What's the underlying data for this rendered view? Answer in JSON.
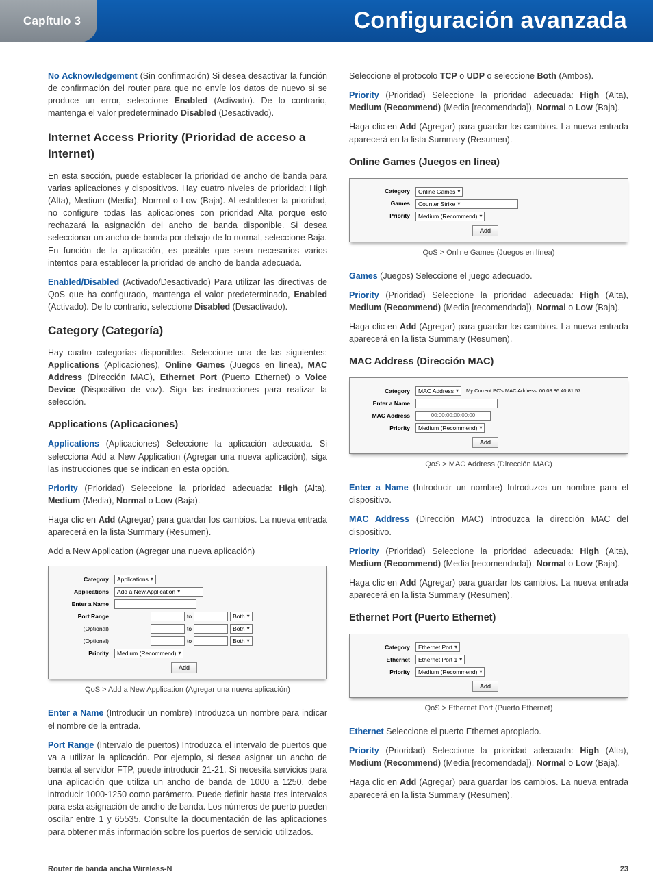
{
  "header": {
    "chapter": "Capítulo 3",
    "title": "Configuración avanzada"
  },
  "left": {
    "p1": {
      "term": "No Acknowledgement",
      "body1": " (Sin confirmación) Si desea desactivar la función de confirmación del router para que no envíe los datos de nuevo si se produce un error, seleccione ",
      "b1": "Enabled",
      "body2": " (Activado). De lo contrario, mantenga el valor predeterminado ",
      "b2": "Disabled",
      "body3": " (Desactivado)."
    },
    "h2_iap": "Internet Access Priority (Prioridad de acceso a Internet)",
    "p2": "En esta sección, puede establecer la prioridad de ancho de banda para varias aplicaciones y dispositivos. Hay cuatro niveles de prioridad: High (Alta), Medium (Media), Normal o Low (Baja). Al establecer la prioridad, no configure todas las aplicaciones con prioridad Alta porque esto rechazará la asignación del ancho de banda disponible. Si desea seleccionar un ancho de banda por debajo de lo normal, seleccione Baja. En función de la aplicación, es posible que sean necesarios varios intentos para establecer la prioridad de ancho de banda adecuada.",
    "p3": {
      "term": "Enabled/Disabled",
      "body1": " (Activado/Desactivado)  Para utilizar las directivas de QoS que ha configurado, mantenga el valor predeterminado, ",
      "b1": "Enabled",
      "body2": " (Activado). De lo contrario, seleccione ",
      "b2": "Disabled",
      "body3": " (Desactivado)."
    },
    "h2_cat": "Category (Categoría)",
    "p4": {
      "body1": "Hay cuatro categorías disponibles. Seleccione una de las siguientes: ",
      "b1": "Applications",
      "t1": " (Aplicaciones), ",
      "b2": "Online Games",
      "t2": " (Juegos en línea), ",
      "b3": "MAC Address",
      "t3": " (Dirección MAC), ",
      "b4": "Ethernet Port",
      "t4": " (Puerto Ethernet) o ",
      "b5": "Voice Device",
      "t5": " (Dispositivo de voz). Siga las instrucciones para realizar la selección."
    },
    "h3_apps": "Applications (Aplicaciones)",
    "p5": {
      "term": "Applications",
      "body": "  (Aplicaciones) Seleccione la aplicación adecuada. Si selecciona Add a New Application (Agregar una nueva aplicación), siga las instrucciones que se indican en esta opción."
    },
    "p6": {
      "term": "Priority",
      "body1": " (Prioridad) Seleccione la prioridad adecuada: ",
      "b1": "High",
      "t1": " (Alta), ",
      "b2": "Medium",
      "t2": " (Media), ",
      "b3": "Normal",
      "t3": " o ",
      "b4": "Low",
      "t4": " (Baja)."
    },
    "p7": {
      "body1": "Haga clic en ",
      "b1": "Add",
      "body2": " (Agregar) para guardar los cambios. La nueva entrada aparecerá en la lista Summary (Resumen)."
    },
    "p8": "Add a New Application (Agregar una nueva aplicación)",
    "shot_apps": {
      "category_lbl": "Category",
      "category_val": "Applications",
      "applications_lbl": "Applications",
      "applications_val": "Add a New Application",
      "entername_lbl": "Enter a Name",
      "portrange_lbl": "Port Range",
      "optional": "(Optional)",
      "to": "to",
      "both": "Both",
      "priority_lbl": "Priority",
      "priority_val": "Medium (Recommend)",
      "add_btn": "Add"
    },
    "cap_apps": "QoS > Add a New Application (Agregar una nueva aplicación)",
    "p9": {
      "term": "Enter a Name",
      "body": "  (Introducir un nombre) Introduzca un nombre para indicar el nombre de la entrada."
    },
    "p10": {
      "term": "Port Range",
      "body": "  (Intervalo de puertos) Introduzca el intervalo de puertos que va a utilizar la aplicación. Por ejemplo, si desea asignar un ancho de banda al servidor FTP, puede introducir 21-21. Si necesita servicios para una aplicación que utiliza un ancho de banda de 1000 a 1250, debe introducir 1000-1250 como parámetro. Puede definir hasta tres intervalos para esta asignación de ancho de banda. Los números de puerto pueden oscilar entre 1 y 65535. Consulte la documentación de las aplicaciones para obtener más información sobre los puertos de servicio utilizados."
    }
  },
  "right": {
    "p1": {
      "body1": "Seleccione el protocolo ",
      "b1": "TCP",
      "t1": " o ",
      "b2": "UDP",
      "t2": " o seleccione ",
      "b3": "Both",
      "t3": " (Ambos)."
    },
    "p2": {
      "term": "Priority",
      "body1": " (Prioridad) Seleccione la prioridad adecuada: ",
      "b1": "High",
      "t1": " (Alta), ",
      "b2": "Medium (Recommend)",
      "t2": " (Media [recomendada]), ",
      "b3": "Normal",
      "t3": " o ",
      "b4": "Low",
      "t4": " (Baja)."
    },
    "p3": {
      "body1": "Haga clic en ",
      "b1": "Add",
      "body2": " (Agregar) para guardar los cambios. La nueva entrada aparecerá en la lista Summary (Resumen)."
    },
    "h3_og": "Online Games (Juegos en línea)",
    "shot_og": {
      "category_lbl": "Category",
      "category_val": "Online Games",
      "games_lbl": "Games",
      "games_val": "Counter Strike",
      "priority_lbl": "Priority",
      "priority_val": "Medium (Recommend)",
      "add_btn": "Add"
    },
    "cap_og": "QoS > Online Games (Juegos en línea)",
    "p4": {
      "term": "Games",
      "body": "  (Juegos) Seleccione el juego adecuado."
    },
    "p5": {
      "term": "Priority",
      "body1": " (Prioridad) Seleccione la prioridad adecuada: ",
      "b1": "High",
      "t1": " (Alta), ",
      "b2": "Medium (Recommend)",
      "t2": " (Media [recomendada]), ",
      "b3": "Normal",
      "t3": " o ",
      "b4": "Low",
      "t4": " (Baja)."
    },
    "p6": {
      "body1": "Haga clic en ",
      "b1": "Add",
      "body2": " (Agregar) para guardar los cambios. La nueva entrada aparecerá en la lista Summary (Resumen)."
    },
    "h3_mac": "MAC Address (Dirección MAC)",
    "shot_mac": {
      "category_lbl": "Category",
      "category_val": "MAC Address",
      "side": "My Current PC's MAC Address: 00:08:86:40:81:57",
      "entername_lbl": "Enter a Name",
      "mac_lbl": "MAC Address",
      "mac_val": "00:00:00:00:00:00",
      "priority_lbl": "Priority",
      "priority_val": "Medium (Recommend)",
      "add_btn": "Add"
    },
    "cap_mac": "QoS > MAC Address (Dirección MAC)",
    "p7": {
      "term": "Enter a Name",
      "body": "  (Introducir un nombre) Introduzca un nombre para el dispositivo."
    },
    "p8": {
      "term": "MAC Address",
      "body": "  (Dirección MAC) Introduzca la dirección MAC del dispositivo."
    },
    "p9": {
      "term": "Priority",
      "body1": " (Prioridad) Seleccione la prioridad adecuada: ",
      "b1": "High",
      "t1": " (Alta), ",
      "b2": "Medium (Recommend)",
      "t2": " (Media [recomendada]), ",
      "b3": "Normal",
      "t3": " o ",
      "b4": "Low",
      "t4": " (Baja)."
    },
    "p10": {
      "body1": "Haga clic en ",
      "b1": "Add",
      "body2": " (Agregar) para guardar los cambios. La nueva entrada aparecerá en la lista Summary (Resumen)."
    },
    "h3_ep": "Ethernet Port (Puerto Ethernet)",
    "shot_ep": {
      "category_lbl": "Category",
      "category_val": "Ethernet Port",
      "eth_lbl": "Ethernet",
      "eth_val": "Ethernet Port 1",
      "priority_lbl": "Priority",
      "priority_val": "Medium (Recommend)",
      "add_btn": "Add"
    },
    "cap_ep": "QoS > Ethernet Port (Puerto Ethernet)",
    "p11": {
      "term": "Ethernet",
      "body": "  Seleccione el puerto Ethernet apropiado."
    },
    "p12": {
      "term": "Priority",
      "body1": " (Prioridad) Seleccione la prioridad adecuada: ",
      "b1": "High",
      "t1": " (Alta), ",
      "b2": "Medium (Recommend)",
      "t2": " (Media [recomendada]), ",
      "b3": "Normal",
      "t3": " o ",
      "b4": "Low",
      "t4": " (Baja)."
    },
    "p13": {
      "body1": "Haga clic en ",
      "b1": "Add",
      "body2": " (Agregar) para guardar los cambios. La nueva entrada aparecerá en la lista Summary (Resumen)."
    }
  },
  "footer": {
    "left": "Router de banda ancha Wireless-N",
    "right": "23"
  }
}
